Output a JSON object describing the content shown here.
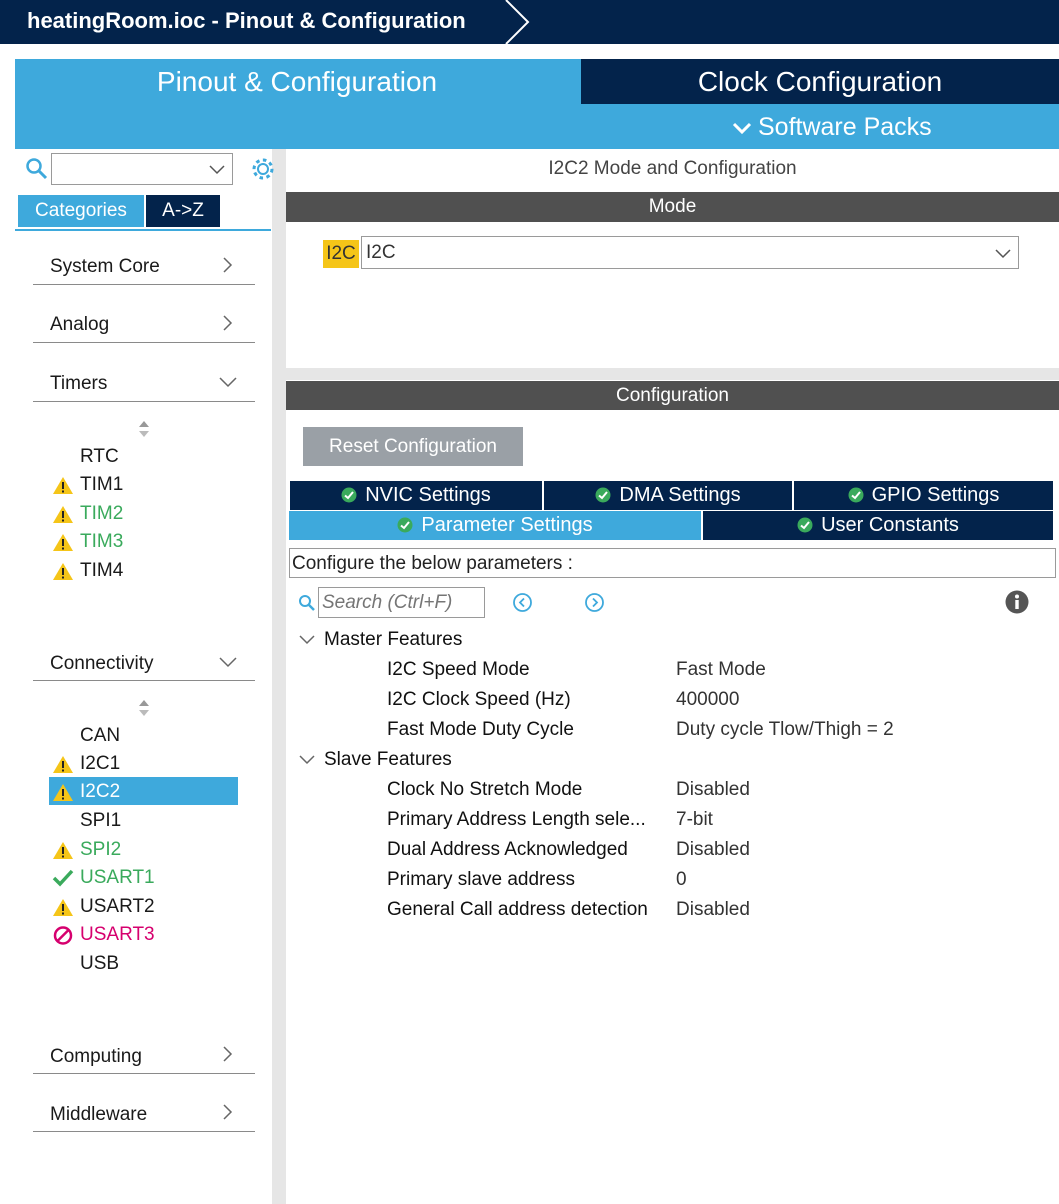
{
  "window": {
    "breadcrumb": "heatingRoom.ioc - Pinout & Configuration"
  },
  "main_tabs": {
    "pinout": "Pinout & Configuration",
    "clock": "Clock Configuration",
    "software_packs": "Software Packs"
  },
  "left": {
    "search_value": "",
    "view_tabs": [
      "Categories",
      "A->Z"
    ],
    "categories": [
      {
        "label": "System Core",
        "state": "collapsed"
      },
      {
        "label": "Analog",
        "state": "collapsed"
      },
      {
        "label": "Timers",
        "state": "expanded"
      },
      {
        "label": "Connectivity",
        "state": "expanded"
      },
      {
        "label": "Computing",
        "state": "collapsed"
      },
      {
        "label": "Middleware",
        "state": "collapsed"
      }
    ],
    "timers_items": [
      {
        "label": "RTC",
        "status": "none",
        "color": "#1a1a1a"
      },
      {
        "label": "TIM1",
        "status": "warning",
        "color": "#1a1a1a"
      },
      {
        "label": "TIM2",
        "status": "warning",
        "color": "#3aaa5c"
      },
      {
        "label": "TIM3",
        "status": "warning",
        "color": "#3aaa5c"
      },
      {
        "label": "TIM4",
        "status": "warning",
        "color": "#1a1a1a"
      }
    ],
    "connectivity_items": [
      {
        "label": "CAN",
        "status": "none",
        "color": "#1a1a1a"
      },
      {
        "label": "I2C1",
        "status": "warning",
        "color": "#1a1a1a"
      },
      {
        "label": "I2C2",
        "status": "warning",
        "color": "#ffffff",
        "selected": true
      },
      {
        "label": "SPI1",
        "status": "none",
        "color": "#1a1a1a"
      },
      {
        "label": "SPI2",
        "status": "warning",
        "color": "#3aaa5c"
      },
      {
        "label": "USART1",
        "status": "ok",
        "color": "#3aaa5c"
      },
      {
        "label": "USART2",
        "status": "warning",
        "color": "#1a1a1a"
      },
      {
        "label": "USART3",
        "status": "disabled",
        "color": "#d6006e"
      },
      {
        "label": "USB",
        "status": "none",
        "color": "#1a1a1a"
      }
    ]
  },
  "right": {
    "title": "I2C2 Mode and Configuration",
    "mode_header": "Mode",
    "mode_tag": "I2C",
    "mode_value": "I2C",
    "config_header": "Configuration",
    "reset_button": "Reset Configuration",
    "settings_tabs_row1": [
      "NVIC Settings",
      "DMA Settings",
      "GPIO Settings"
    ],
    "settings_tabs_row2": [
      "Parameter Settings",
      "User Constants"
    ],
    "description": "Configure the below parameters :",
    "search_placeholder": "Search (Ctrl+F)",
    "groups": [
      {
        "name": "Master Features",
        "params": [
          {
            "name": "I2C Speed Mode",
            "value": "Fast Mode"
          },
          {
            "name": "I2C Clock Speed (Hz)",
            "value": "400000"
          },
          {
            "name": "Fast Mode Duty Cycle",
            "value": "Duty cycle Tlow/Thigh = 2"
          }
        ]
      },
      {
        "name": "Slave Features",
        "params": [
          {
            "name": "Clock No Stretch Mode",
            "value": "Disabled"
          },
          {
            "name": "Primary Address Length sele...",
            "value": "7-bit"
          },
          {
            "name": "Dual Address Acknowledged",
            "value": "Disabled"
          },
          {
            "name": "Primary slave address",
            "value": "0"
          },
          {
            "name": "General Call address detection",
            "value": "Disabled"
          }
        ]
      }
    ]
  },
  "colors": {
    "navy": "#03234b",
    "accent_blue": "#3ea9dc",
    "warning": "#f5c518",
    "ok_green": "#3aaa5c",
    "disabled_pink": "#d6006e"
  }
}
